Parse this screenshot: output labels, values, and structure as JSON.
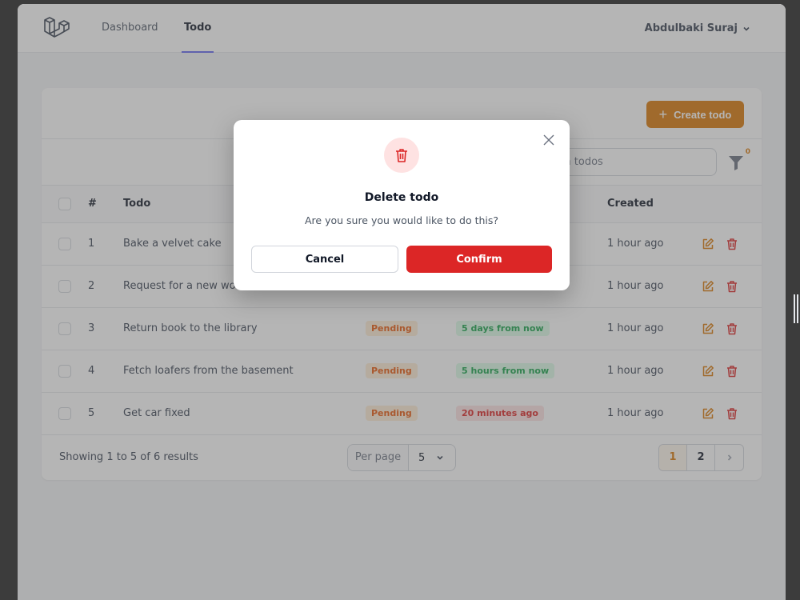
{
  "nav": {
    "links": [
      {
        "label": "Dashboard",
        "active": false
      },
      {
        "label": "Todo",
        "active": true
      }
    ],
    "user_name": "Abdulbaki Suraj"
  },
  "card": {
    "create_label": "Create todo",
    "search_placeholder": "Search todos",
    "filter_count": "0",
    "columns": {
      "num": "#",
      "todo": "Todo",
      "created": "Created"
    },
    "rows": [
      {
        "num": "1",
        "todo": "Bake a velvet cake",
        "status": "",
        "due": "",
        "due_tone": "",
        "created": "1 hour ago"
      },
      {
        "num": "2",
        "todo": "Request for a new work",
        "status": "",
        "due": "",
        "due_tone": "",
        "created": "1 hour ago"
      },
      {
        "num": "3",
        "todo": "Return book to the library",
        "status": "Pending",
        "due": "5 days from now",
        "due_tone": "green",
        "created": "1 hour ago"
      },
      {
        "num": "4",
        "todo": "Fetch loafers from the basement",
        "status": "Pending",
        "due": "5 hours from now",
        "due_tone": "green",
        "created": "1 hour ago"
      },
      {
        "num": "5",
        "todo": "Get car fixed",
        "status": "Pending",
        "due": "20 minutes ago",
        "due_tone": "red",
        "created": "1 hour ago"
      }
    ],
    "footer": {
      "showing": "Showing 1 to 5 of 6 results",
      "per_page_label": "Per page",
      "per_page_value": "5",
      "pages": [
        "1",
        "2"
      ],
      "current_page": "1"
    }
  },
  "modal": {
    "title": "Delete todo",
    "description": "Are you sure you would like to do this?",
    "cancel_label": "Cancel",
    "confirm_label": "Confirm"
  },
  "colors": {
    "accent": "#d97706",
    "danger": "#dc2626",
    "edit_icon": "#d97706",
    "nav_underline": "#6366f1"
  },
  "icons": {
    "logo": "laravel-logo",
    "user_menu": "chevron-down-icon",
    "create": "plus-icon",
    "filter": "funnel-icon",
    "edit": "pencil-square-icon",
    "delete": "trash-icon",
    "modal": "trash-icon",
    "close": "close-icon",
    "next": "chevron-right-icon"
  }
}
